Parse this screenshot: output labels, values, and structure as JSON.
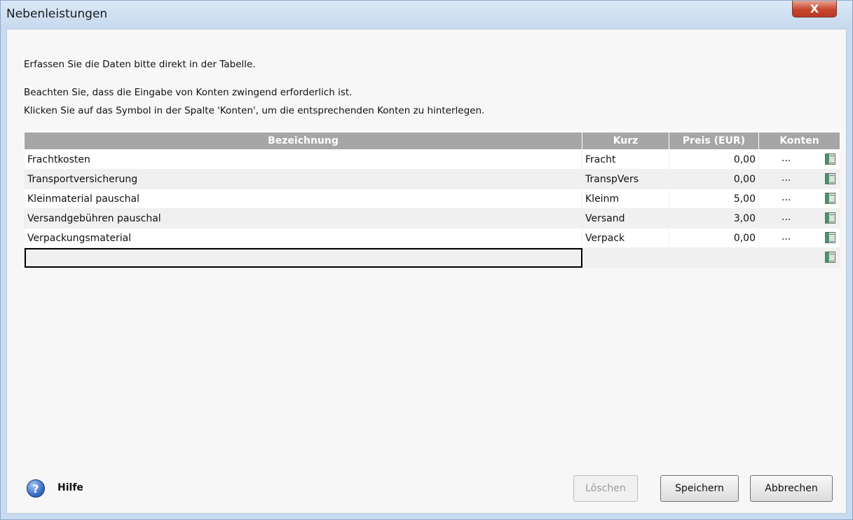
{
  "window": {
    "title": "Nebenleistungen",
    "close_label": "X"
  },
  "instructions": {
    "line1": "Erfassen Sie die Daten bitte direkt in der Tabelle.",
    "line2": "Beachten Sie, dass die Eingabe von Konten zwingend erforderlich ist.",
    "line3": "Klicken Sie auf das Symbol in der Spalte 'Konten', um die entsprechenden Konten zu  hinterlegen."
  },
  "table": {
    "columns": [
      "Bezeichnung",
      "Kurz",
      "Preis (EUR)",
      "Konten"
    ],
    "rows": [
      {
        "bezeichnung": "Frachtkosten",
        "kurz": "Fracht",
        "preis": "0,00",
        "konten": "..."
      },
      {
        "bezeichnung": "Transportversicherung",
        "kurz": "TranspVers",
        "preis": "0,00",
        "konten": "..."
      },
      {
        "bezeichnung": "Kleinmaterial pauschal",
        "kurz": "Kleinm",
        "preis": "5,00",
        "konten": "..."
      },
      {
        "bezeichnung": "Versandgebühren pauschal",
        "kurz": "Versand",
        "preis": "3,00",
        "konten": "..."
      },
      {
        "bezeichnung": "Verpackungsmaterial",
        "kurz": "Verpack",
        "preis": "0,00",
        "konten": "..."
      }
    ],
    "new_row": {
      "bezeichnung": ""
    }
  },
  "footer": {
    "help_label": "Hilfe",
    "delete_label": "Löschen",
    "save_label": "Speichern",
    "cancel_label": "Abbrechen"
  },
  "icons": {
    "close": "close-icon",
    "help": "help-icon",
    "konto": "account-table-icon"
  },
  "colors": {
    "header_bg": "#a6a6a6",
    "row_even": "#f0f0f0",
    "help_blue": "#3a6fc4",
    "close_red": "#c8462d"
  }
}
